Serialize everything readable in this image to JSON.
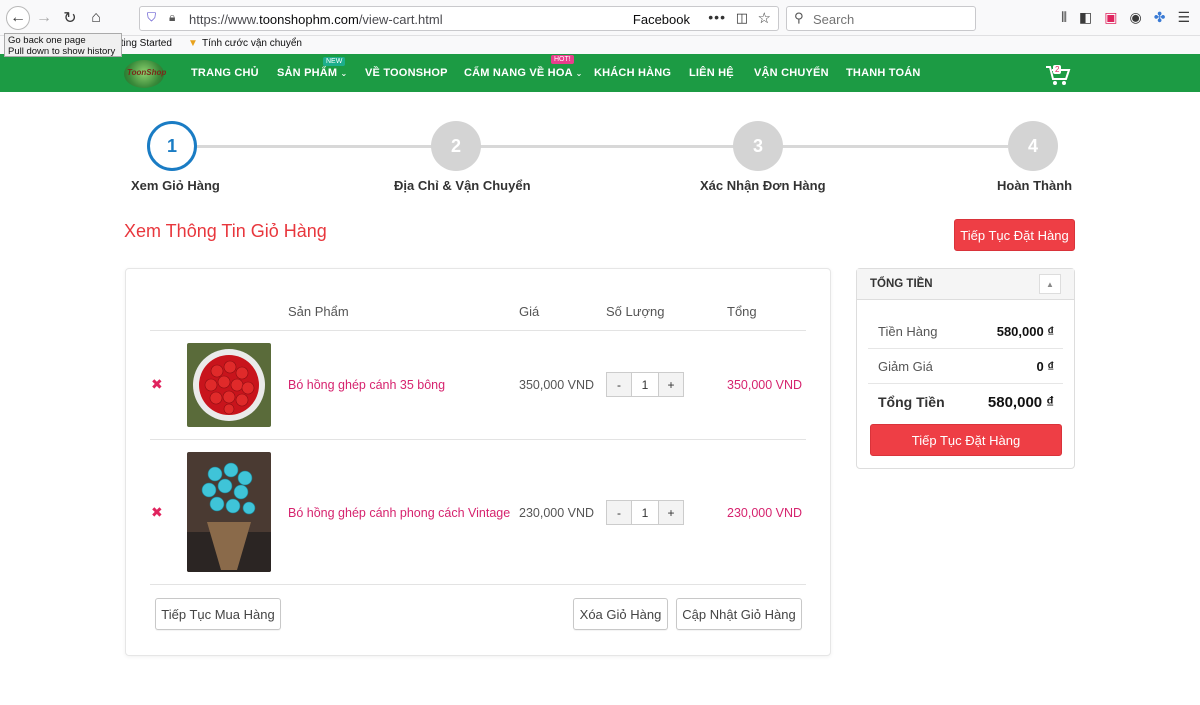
{
  "browser": {
    "url_scheme": "https://www.",
    "url_host": "toonshophm.com",
    "url_path": "/view-cart.html",
    "url_right_label": "Facebook",
    "search_placeholder": "Search",
    "tooltip_line1": "Go back one page",
    "tooltip_line2": "Pull down to show history",
    "bookmarks": [
      "tting Started",
      "Tính cước vận chuyển"
    ]
  },
  "nav": {
    "items": [
      "TRANG CHỦ",
      "SẢN PHẨM",
      "VỀ TOONSHOP",
      "CẨM NANG VỀ HOA",
      "KHÁCH HÀNG",
      "LIÊN HỆ",
      "VẬN CHUYỂN",
      "THANH TOÁN"
    ],
    "badge_new": "NEW",
    "badge_hot": "HOT!",
    "cart_count": "2",
    "logo_text": "ToonShop"
  },
  "steps": [
    {
      "num": "1",
      "label": "Xem Giỏ Hàng"
    },
    {
      "num": "2",
      "label": "Địa Chỉ & Vận Chuyển"
    },
    {
      "num": "3",
      "label": "Xác Nhận Đơn Hàng"
    },
    {
      "num": "4",
      "label": "Hoàn Thành"
    }
  ],
  "cart": {
    "title": "Xem Thông Tin Giỏ Hàng",
    "continue_order": "Tiếp Tục Đặt Hàng",
    "headers": {
      "product": "Sản Phẩm",
      "price": "Giá",
      "qty": "Số Lượng",
      "total": "Tổng"
    },
    "items": [
      {
        "name": "Bó hồng ghép cánh 35 bông",
        "price": "350,000 VND",
        "qty": "1",
        "total": "350,000 VND"
      },
      {
        "name": "Bó hồng ghép cánh phong cách Vintage",
        "price": "230,000 VND",
        "qty": "1",
        "total": "230,000 VND"
      }
    ],
    "remove_glyph": "✖",
    "minus": "-",
    "plus": "+",
    "continue_shopping": "Tiếp Tục Mua Hàng",
    "clear_cart": "Xóa Giỏ Hàng",
    "update_cart": "Cập Nhật Giỏ Hàng"
  },
  "summary": {
    "title": "TỔNG TIỀN",
    "subtotal_label": "Tiền Hàng",
    "subtotal": "580,000 ₫",
    "discount_label": "Giảm Giá",
    "discount": "0 ₫",
    "total_label": "Tổng Tiền",
    "total": "580,000 ₫",
    "button": "Tiếp Tục Đặt Hàng"
  },
  "colors": {
    "nav_green": "#1c9b44",
    "accent_red": "#ee3e45",
    "link_pink": "#d6236e",
    "step_blue": "#1a7cc4"
  },
  "icons": [
    "back-icon",
    "forward-icon",
    "reload-icon",
    "home-icon",
    "shield-icon",
    "lock-icon",
    "reader-icon",
    "more-icon",
    "pocket-icon",
    "star-icon",
    "search-icon",
    "library-icon",
    "sidebar-icon",
    "bars-icon",
    "download-icon",
    "account-icon",
    "gift-icon",
    "menu-icon",
    "cart-icon",
    "remove-icon",
    "chevron-down-icon",
    "chevron-up-icon"
  ]
}
